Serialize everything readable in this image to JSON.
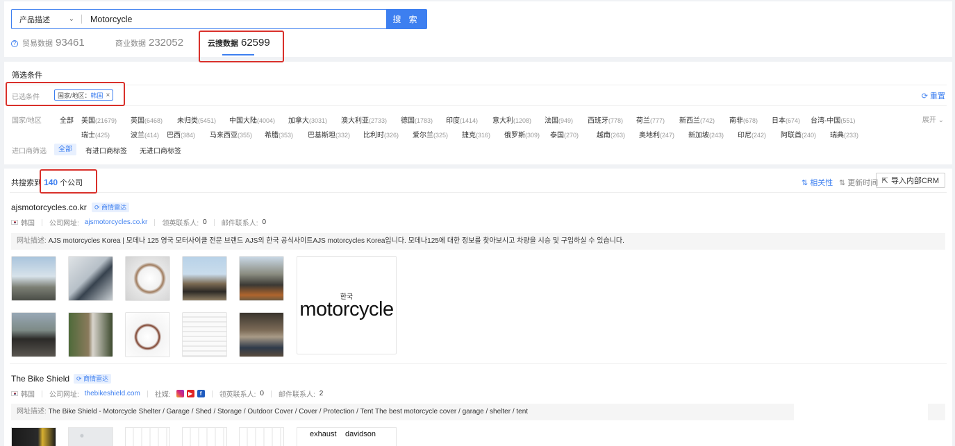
{
  "search": {
    "type_label": "产品描述",
    "query": "Motorcycle",
    "button_label": "搜 索"
  },
  "data_tabs": [
    {
      "label": "贸易数据",
      "count": "93461"
    },
    {
      "label": "商业数据",
      "count": "232052"
    },
    {
      "label": "云搜数据",
      "count": "62599"
    }
  ],
  "filters": {
    "title": "筛选条件",
    "selected_label": "已选条件",
    "selected_chip": {
      "key": "国家/地区：",
      "value": "韩国",
      "close": "×"
    },
    "reset_label": "重置",
    "country_label": "国家/地区",
    "expand_label": "展开",
    "countries_row1": [
      {
        "name": "全部",
        "count": ""
      },
      {
        "name": "美国",
        "count": "(21679)"
      },
      {
        "name": "英国",
        "count": "(6468)"
      },
      {
        "name": "未归类",
        "count": "(5451)"
      },
      {
        "name": "中国大陆",
        "count": "(4004)"
      },
      {
        "name": "加拿大",
        "count": "(3031)"
      },
      {
        "name": "澳大利亚",
        "count": "(2733)"
      },
      {
        "name": "德国",
        "count": "(1783)"
      },
      {
        "name": "印度",
        "count": "(1414)"
      },
      {
        "name": "意大利",
        "count": "(1208)"
      },
      {
        "name": "法国",
        "count": "(949)"
      },
      {
        "name": "西班牙",
        "count": "(778)"
      },
      {
        "name": "荷兰",
        "count": "(777)"
      },
      {
        "name": "新西兰",
        "count": "(742)"
      },
      {
        "name": "南非",
        "count": "(678)"
      },
      {
        "name": "日本",
        "count": "(674)"
      },
      {
        "name": "台湾-中国",
        "count": "(551)"
      }
    ],
    "countries_row2": [
      {
        "name": "瑞士",
        "count": "(425)"
      },
      {
        "name": "波兰",
        "count": "(414)"
      },
      {
        "name": "巴西",
        "count": "(384)"
      },
      {
        "name": "马来西亚",
        "count": "(355)"
      },
      {
        "name": "希腊",
        "count": "(353)"
      },
      {
        "name": "巴基斯坦",
        "count": "(332)"
      },
      {
        "name": "比利时",
        "count": "(326)"
      },
      {
        "name": "爱尔兰",
        "count": "(325)"
      },
      {
        "name": "捷克",
        "count": "(316)"
      },
      {
        "name": "俄罗斯",
        "count": "(309)"
      },
      {
        "name": "泰国",
        "count": "(270)"
      },
      {
        "name": "越南",
        "count": "(263)"
      },
      {
        "name": "奥地利",
        "count": "(247)"
      },
      {
        "name": "新加坡",
        "count": "(243)"
      },
      {
        "name": "印尼",
        "count": "(242)"
      },
      {
        "name": "阿联酋",
        "count": "(240)"
      },
      {
        "name": "瑞典",
        "count": "(233)"
      }
    ],
    "importer_label": "进口商筛选",
    "importer_options": [
      "全部",
      "有进口商标签",
      "无进口商标签"
    ]
  },
  "results": {
    "prefix": "共搜索到",
    "count": "140",
    "suffix": "个公司",
    "sort_relevance": "相关性",
    "sort_time": "更新时间",
    "crm_button": "导入内部CRM",
    "items": [
      {
        "name": "ajsmotorcycles.co.kr",
        "badge": "商情雷达",
        "country": "韩国",
        "website_label": "公司网址:",
        "website": "ajsmotorcycles.co.kr",
        "linkedin_label": "领英联系人:",
        "linkedin_count": "0",
        "email_label": "邮件联系人:",
        "email_count": "0",
        "desc_label": "网址描述:",
        "description": "AJS motorcycles Korea | 모데나 125 영국 모터사이클 전문 브랜드 AJS의 한국 공식사이트AJS motorcycles Korea입니다. 모데나125에 대한 정보를 찾아보시고 차량을 시승 및 구입하실 수 있습니다.",
        "logo_small": "한국",
        "logo_big": "motorcycle"
      },
      {
        "name": "The Bike Shield",
        "badge": "商情雷达",
        "country": "韩国",
        "website_label": "公司网址:",
        "website": "thebikeshield.com",
        "social_label": "社媒:",
        "linkedin_label": "领英联系人:",
        "linkedin_count": "0",
        "email_label": "邮件联系人:",
        "email_count": "2",
        "desc_label": "网址描述:",
        "description": "The Bike Shield - Motorcycle Shelter / Garage / Shed / Storage / Outdoor Cover / Cover / Protection / Tent The best motorcycle cover / garage / shelter / tent",
        "logo_words": [
          "exhaust",
          "davidson"
        ]
      }
    ]
  },
  "colors": {
    "accent": "#3d7ff0",
    "highlight_box": "#d9302a"
  }
}
